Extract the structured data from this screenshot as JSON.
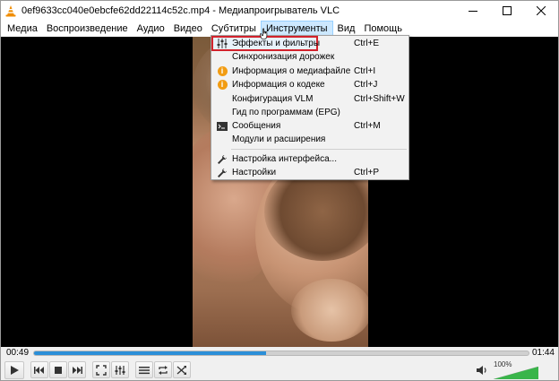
{
  "window": {
    "title": "0ef9633cc040e0ebcfe62dd22114c52c.mp4 - Медиапроигрыватель VLC",
    "accent": "#2b8fd8",
    "icons": [
      "vlc-cone-icon",
      "minimize-icon",
      "maximize-icon",
      "close-icon"
    ]
  },
  "menubar": {
    "items": [
      {
        "label": "Медиа"
      },
      {
        "label": "Воспроизведение"
      },
      {
        "label": "Аудио"
      },
      {
        "label": "Видео"
      },
      {
        "label": "Субтитры"
      },
      {
        "label": "Инструменты"
      },
      {
        "label": "Вид"
      },
      {
        "label": "Помощь"
      }
    ],
    "active": "Инструменты"
  },
  "tools_menu": {
    "items": [
      {
        "label": "Эффекты и фильтры",
        "shortcut": "Ctrl+E",
        "icon": "equalizer-icon"
      },
      {
        "label": "Синхронизация дорожек",
        "shortcut": "",
        "icon": ""
      },
      {
        "label": "Информация о медиафайле",
        "shortcut": "Ctrl+I",
        "icon": "info-icon"
      },
      {
        "label": "Информация о кодеке",
        "shortcut": "Ctrl+J",
        "icon": "info-icon"
      },
      {
        "label": "Конфигурация VLM",
        "shortcut": "Ctrl+Shift+W",
        "icon": ""
      },
      {
        "label": "Гид по программам (EPG)",
        "shortcut": "",
        "icon": ""
      },
      {
        "label": "Сообщения",
        "shortcut": "Ctrl+M",
        "icon": "terminal-icon"
      },
      {
        "label": "Модули и расширения",
        "shortcut": "",
        "icon": ""
      },
      {
        "label": "Настройка интерфейса...",
        "shortcut": "",
        "icon": "wrench-icon"
      },
      {
        "label": "Настройки",
        "shortcut": "Ctrl+P",
        "icon": "wrench-icon"
      }
    ],
    "highlighted": "Эффекты и фильтры"
  },
  "playback": {
    "elapsed": "00:49",
    "total": "01:44",
    "progress_fraction": 0.47
  },
  "controls": {
    "icons": [
      "play-icon",
      "previous-icon",
      "stop-icon",
      "next-icon",
      "fullscreen-icon",
      "extended-settings-icon",
      "playlist-icon",
      "loop-icon",
      "shuffle-icon"
    ]
  },
  "volume": {
    "label": "100%",
    "level_fraction": 1.0,
    "color": "#39b54a",
    "icon": "speaker-icon"
  }
}
